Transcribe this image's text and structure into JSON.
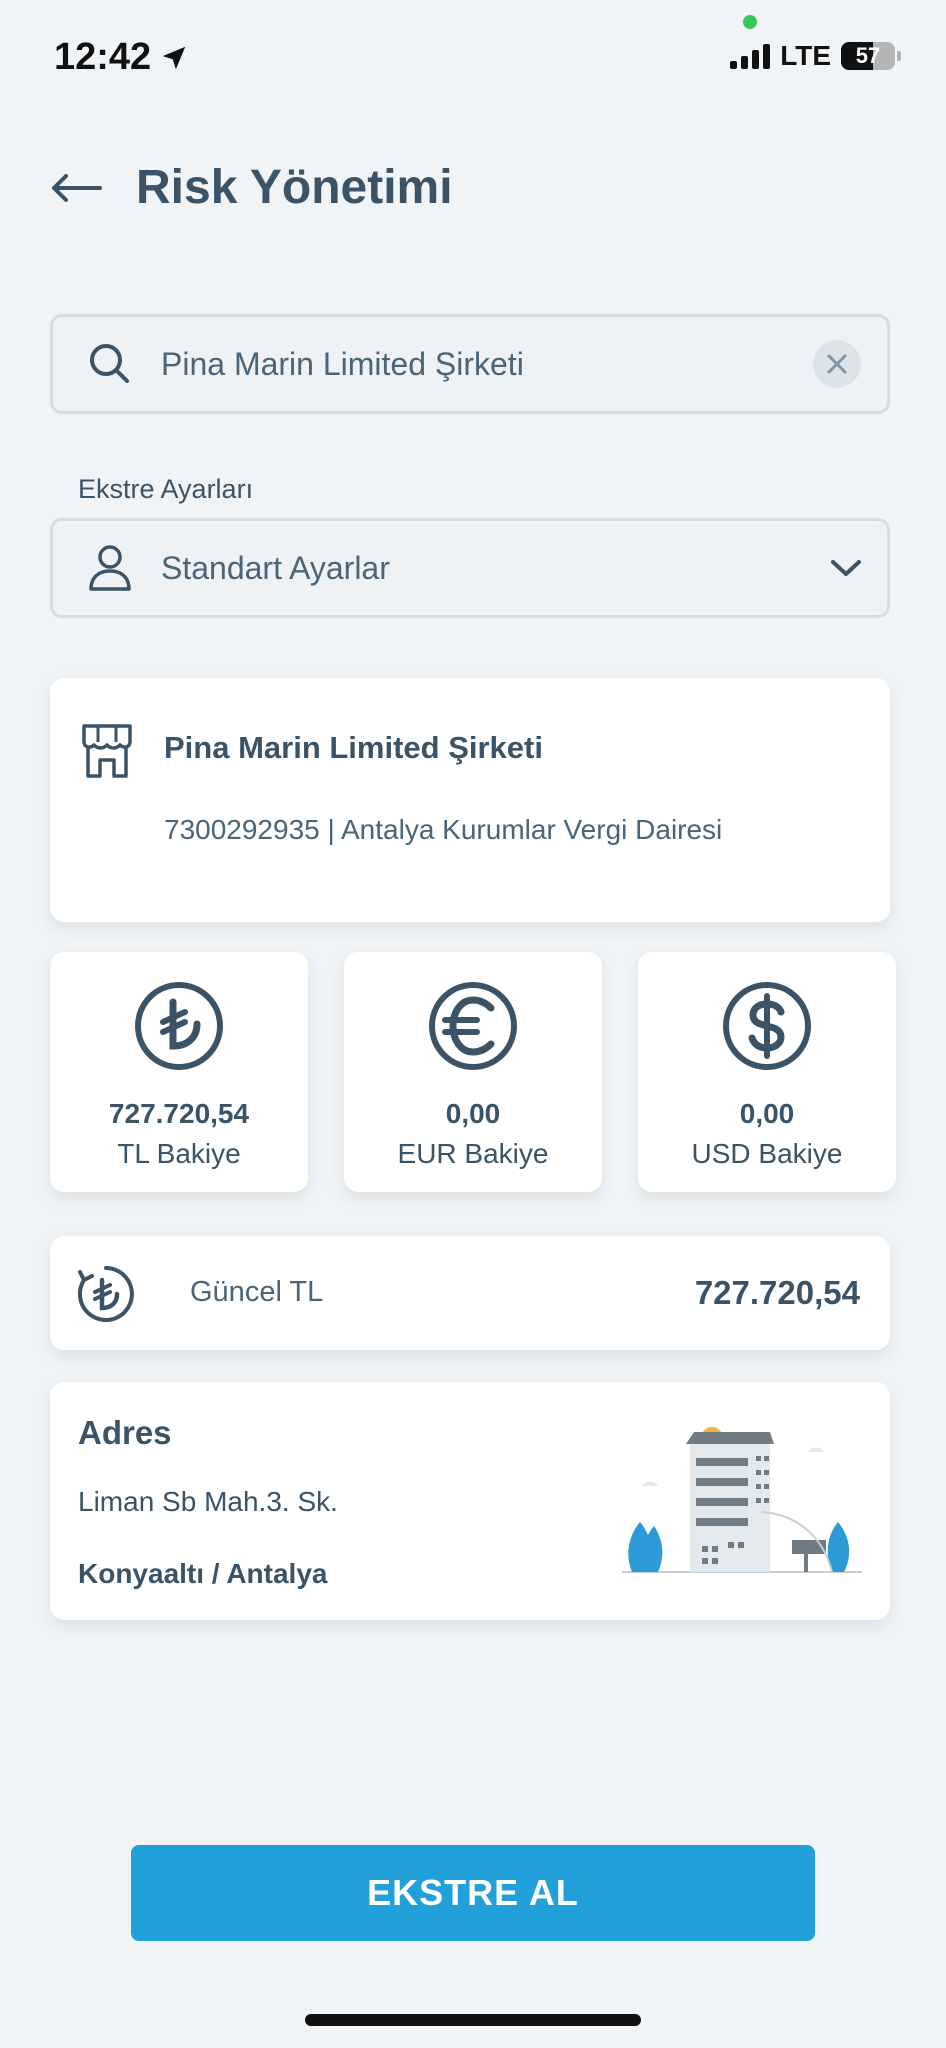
{
  "status": {
    "time": "12:42",
    "network": "LTE",
    "battery": "57"
  },
  "header": {
    "title": "Risk Yönetimi",
    "back_icon": "arrow-left-icon"
  },
  "search": {
    "value": "Pina Marin Limited Şirketi",
    "icon": "search-icon"
  },
  "statement_settings": {
    "label": "Ekstre Ayarları",
    "selected": "Standart Ayarlar"
  },
  "company": {
    "name": "Pina Marin Limited Şirketi",
    "details": "7300292935 | Antalya Kurumlar Vergi Dairesi"
  },
  "balances": [
    {
      "amount": "727.720,54",
      "label": "TL Bakiye",
      "icon": "lira-icon"
    },
    {
      "amount": "0,00",
      "label": "EUR Bakiye",
      "icon": "euro-icon"
    },
    {
      "amount": "0,00",
      "label": "USD Bakiye",
      "icon": "dollar-icon"
    }
  ],
  "current": {
    "label": "Güncel TL",
    "amount": "727.720,54"
  },
  "address": {
    "title": "Adres",
    "line1": "Liman Sb Mah.3. Sk.",
    "line2": "Konyaaltı / Antalya"
  },
  "cta": {
    "label": "EKSTRE AL"
  },
  "colors": {
    "primary": "#21a0d9",
    "text": "#3b5366",
    "background": "#f1f4f6"
  }
}
